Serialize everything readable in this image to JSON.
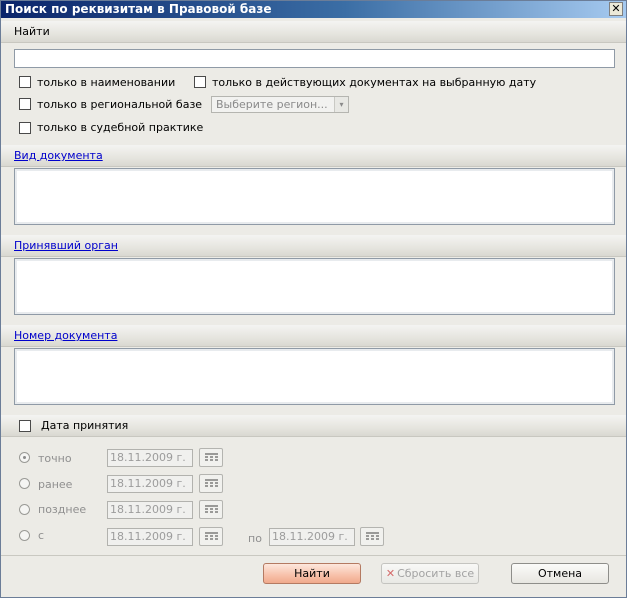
{
  "window": {
    "title": "Поиск по реквизитам в Правовой базе",
    "close_glyph": "✕"
  },
  "find_section": {
    "label": "Найти",
    "query_value": "",
    "options": {
      "name_only": "только в наименовании",
      "active_docs": "только в действующих документах на выбранную дату",
      "regional_base": "только в региональной базе",
      "judicial": "только в судебной практике"
    },
    "region_select": {
      "value": "Выберите регион...",
      "arrow": "▾"
    }
  },
  "doc_type": {
    "label": "Вид документа",
    "value": ""
  },
  "authority": {
    "label": "Принявший орган",
    "value": ""
  },
  "doc_number": {
    "label": "Номер документа",
    "value": ""
  },
  "date_section": {
    "label": "Дата принятия",
    "modes": [
      {
        "label": "точно",
        "date": "18.11.2009 г.",
        "selected": true
      },
      {
        "label": "ранее",
        "date": "18.11.2009 г.",
        "selected": false
      },
      {
        "label": "позднее",
        "date": "18.11.2009 г.",
        "selected": false
      },
      {
        "label": "с",
        "date": "18.11.2009 г.",
        "selected": false
      }
    ],
    "to_label": "по",
    "to_date": "18.11.2009 г."
  },
  "footer": {
    "find_button": "Найти",
    "reset_button": "Сбросить все",
    "reset_icon": "✕",
    "cancel_button": "Отмена"
  },
  "icons": {
    "calendar": "calendar-icon",
    "close": "close-icon"
  },
  "colors": {
    "title_gradient_start": "#0a246a",
    "link": "#0000cc",
    "find_button": "#f7c0a9"
  }
}
